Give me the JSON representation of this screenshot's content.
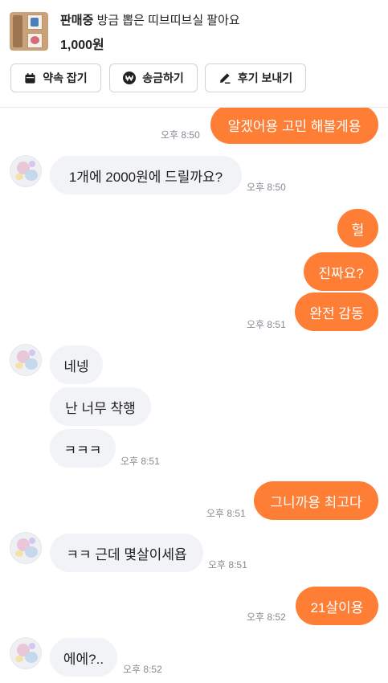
{
  "product": {
    "status": "판매중",
    "title": "방금 뽑은 띠브띠브실 팔아요",
    "price": "1,000원"
  },
  "actions": {
    "appointment": "약속 잡기",
    "send_money": "송금하기",
    "send_review": "후기 보내기"
  },
  "messages": [
    {
      "sender": "me",
      "text": "알겠어용 고민 해볼게용",
      "time": "오후 8:50"
    },
    {
      "sender": "other",
      "text": "1개에 2000원에 드릴까요?",
      "time": "오후 8:50"
    },
    {
      "sender": "me",
      "text": "헐",
      "time": ""
    },
    {
      "sender": "me",
      "text": "진짜요?",
      "time": ""
    },
    {
      "sender": "me",
      "text": "완전 감동",
      "time": "오후 8:51"
    },
    {
      "sender": "other",
      "text": "네넹",
      "time": ""
    },
    {
      "sender": "other",
      "text": "난 너무 착행",
      "time": ""
    },
    {
      "sender": "other",
      "text": "ㅋㅋㅋ",
      "time": "오후 8:51"
    },
    {
      "sender": "me",
      "text": "그니까용 최고다",
      "time": "오후 8:51"
    },
    {
      "sender": "other",
      "text": "ㅋㅋ 근데 몇살이세욥",
      "time": "오후 8:51"
    },
    {
      "sender": "me",
      "text": "21살이용",
      "time": "오후 8:52"
    },
    {
      "sender": "other",
      "text": "에에?..",
      "time": "오후 8:52"
    }
  ],
  "colors": {
    "my_bubble": "#ff7e36",
    "other_bubble": "#f2f3f6",
    "timestamp": "#868b94"
  }
}
